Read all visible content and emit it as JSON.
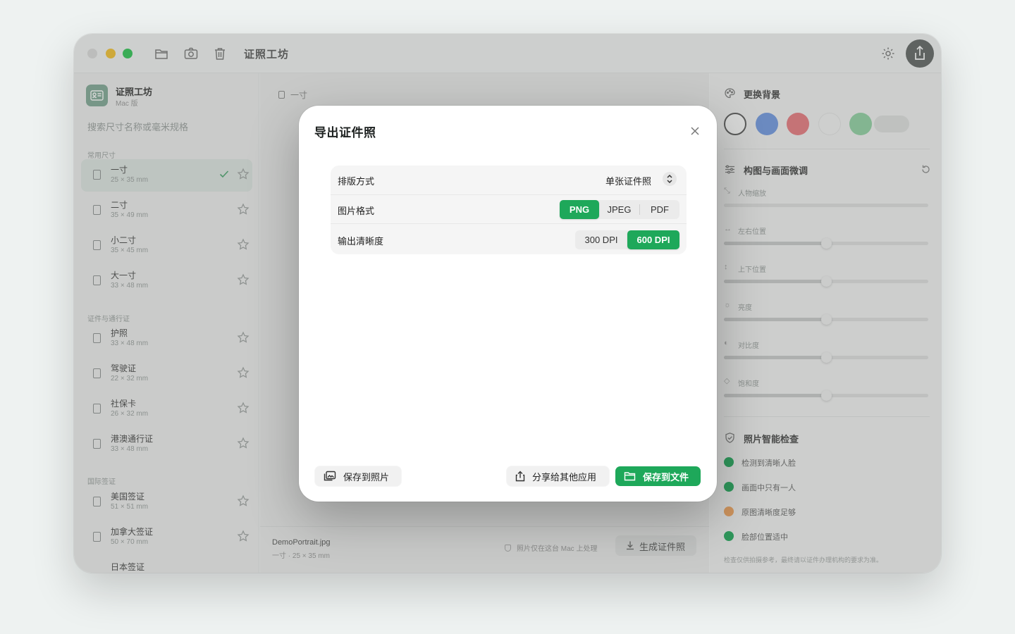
{
  "window": {
    "title": "证照工坊"
  },
  "sidebar": {
    "app_name": "证照工坊",
    "app_sub": "Mac 版",
    "search_placeholder": "搜索尺寸名称或毫米规格",
    "sections": [
      {
        "heading": "常用尺寸",
        "items": [
          {
            "name": "一寸",
            "dim": "25 × 35 mm",
            "selected": true
          },
          {
            "name": "二寸",
            "dim": "35 × 49 mm"
          },
          {
            "name": "小二寸",
            "dim": "35 × 45 mm"
          },
          {
            "name": "大一寸",
            "dim": "33 × 48 mm"
          }
        ]
      },
      {
        "heading": "证件与通行证",
        "items": [
          {
            "name": "护照",
            "dim": "33 × 48 mm"
          },
          {
            "name": "驾驶证",
            "dim": "22 × 32 mm"
          },
          {
            "name": "社保卡",
            "dim": "26 × 32 mm"
          },
          {
            "name": "港澳通行证",
            "dim": "33 × 48 mm"
          }
        ]
      },
      {
        "heading": "国际签证",
        "items": [
          {
            "name": "美国签证",
            "dim": "51 × 51 mm"
          },
          {
            "name": "加拿大签证",
            "dim": "50 × 70 mm"
          },
          {
            "name": "日本签证",
            "dim": ""
          }
        ]
      }
    ]
  },
  "main": {
    "crumb": "一寸",
    "file_name": "DemoPortrait.jpg",
    "file_dim": "一寸 · 25 × 35 mm",
    "privacy": "照片仅在这台 Mac 上处理",
    "generate": "生成证件照"
  },
  "inspector": {
    "bg_heading": "更换背景",
    "swatches": [
      "#ffffff",
      "#6f98e2",
      "#e8787e",
      "#f4f4f4",
      "#8fd1a2"
    ],
    "adjust_heading": "构图与画面微调",
    "sliders": [
      {
        "label": "人物缩放",
        "glyph": "⤡",
        "value": 0.0
      },
      {
        "label": "左右位置",
        "glyph": "↔",
        "value": 0.5
      },
      {
        "label": "上下位置",
        "glyph": "↕",
        "value": 0.5
      },
      {
        "label": "亮度",
        "glyph": "☼",
        "value": 0.5
      },
      {
        "label": "对比度",
        "glyph": "◐",
        "value": 0.5
      },
      {
        "label": "饱和度",
        "glyph": "◇",
        "value": 0.5
      }
    ],
    "check_heading": "照片智能检查",
    "checks": [
      {
        "text": "检测到清晰人脸",
        "status": "ok"
      },
      {
        "text": "画面中只有一人",
        "status": "ok"
      },
      {
        "text": "原图清晰度足够",
        "status": "warn"
      },
      {
        "text": "脸部位置适中",
        "status": "ok"
      }
    ],
    "note": "检查仅供拍摄参考，最终请以证件办理机构的要求为准。"
  },
  "modal": {
    "title": "导出证件照",
    "layout_label": "排版方式",
    "layout_value": "单张证件照",
    "format_label": "图片格式",
    "formats": [
      "PNG",
      "JPEG",
      "PDF"
    ],
    "format_selected": "PNG",
    "dpi_label": "输出清晰度",
    "dpis": [
      "300 DPI",
      "600 DPI"
    ],
    "dpi_selected": "600 DPI",
    "save_photos": "保存到照片",
    "share": "分享给其他应用",
    "save_file": "保存到文件"
  },
  "colors": {
    "accent": "#1ea85a",
    "warn": "#f0a35c"
  }
}
